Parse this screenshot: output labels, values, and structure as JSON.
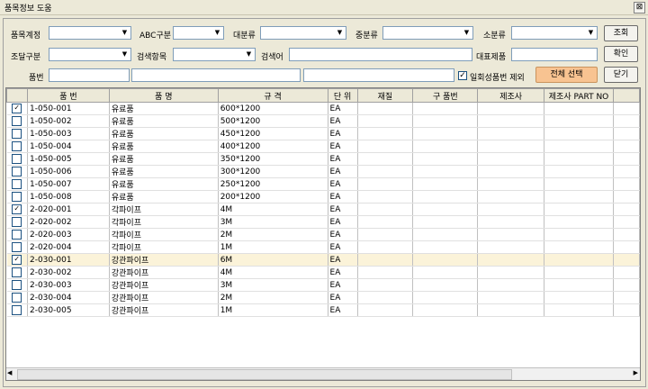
{
  "window": {
    "title": "품목정보 도움",
    "close": "⊠"
  },
  "filters": {
    "item_type_label": "품목계정",
    "abc_label": "ABC구분",
    "major_label": "대분류",
    "middle_label": "중분류",
    "minor_label": "소분류",
    "proc_label": "조달구분",
    "search_item_label": "검색항목",
    "keyword_label": "검색어",
    "rep_item_label": "대표제품",
    "item_no_label": "품번",
    "exclude_label": "일회성품번 제외",
    "exclude_checked": "✓"
  },
  "buttons": {
    "search": "조회",
    "confirm": "확인",
    "select_all": "전체 선택",
    "close": "닫기"
  },
  "table": {
    "headers": [
      "",
      "품 번",
      "품 명",
      "규 격",
      "단 위",
      "재질",
      "구 품번",
      "제조사",
      "제조사 PART NO"
    ],
    "rows": [
      {
        "check": "✓",
        "no": "1-050-001",
        "name": "유료품",
        "spec": "600*1200",
        "unit": "EA"
      },
      {
        "check": "",
        "no": "1-050-002",
        "name": "유료품",
        "spec": "500*1200",
        "unit": "EA"
      },
      {
        "check": "",
        "no": "1-050-003",
        "name": "유료품",
        "spec": "450*1200",
        "unit": "EA"
      },
      {
        "check": "",
        "no": "1-050-004",
        "name": "유료품",
        "spec": "400*1200",
        "unit": "EA"
      },
      {
        "check": "",
        "no": "1-050-005",
        "name": "유료품",
        "spec": "350*1200",
        "unit": "EA"
      },
      {
        "check": "",
        "no": "1-050-006",
        "name": "유료품",
        "spec": "300*1200",
        "unit": "EA"
      },
      {
        "check": "",
        "no": "1-050-007",
        "name": "유료품",
        "spec": "250*1200",
        "unit": "EA"
      },
      {
        "check": "",
        "no": "1-050-008",
        "name": "유료품",
        "spec": "200*1200",
        "unit": "EA"
      },
      {
        "check": "✓",
        "no": "2-020-001",
        "name": "각파이프",
        "spec": "4M",
        "unit": "EA"
      },
      {
        "check": "",
        "no": "2-020-002",
        "name": "각파이프",
        "spec": "3M",
        "unit": "EA"
      },
      {
        "check": "",
        "no": "2-020-003",
        "name": "각파이프",
        "spec": "2M",
        "unit": "EA"
      },
      {
        "check": "",
        "no": "2-020-004",
        "name": "각파이프",
        "spec": "1M",
        "unit": "EA"
      },
      {
        "check": "✓",
        "no": "2-030-001",
        "name": "강관파이프",
        "spec": "6M",
        "unit": "EA"
      },
      {
        "check": "",
        "no": "2-030-002",
        "name": "강관파이프",
        "spec": "4M",
        "unit": "EA"
      },
      {
        "check": "",
        "no": "2-030-003",
        "name": "강관파이프",
        "spec": "3M",
        "unit": "EA"
      },
      {
        "check": "",
        "no": "2-030-004",
        "name": "강관파이프",
        "spec": "2M",
        "unit": "EA"
      },
      {
        "check": "",
        "no": "2-030-005",
        "name": "강관파이프",
        "spec": "1M",
        "unit": "EA"
      }
    ]
  },
  "icons": {
    "dropdown": "chevron-down-icon",
    "scroll_left": "◀",
    "scroll_right": "▶"
  }
}
